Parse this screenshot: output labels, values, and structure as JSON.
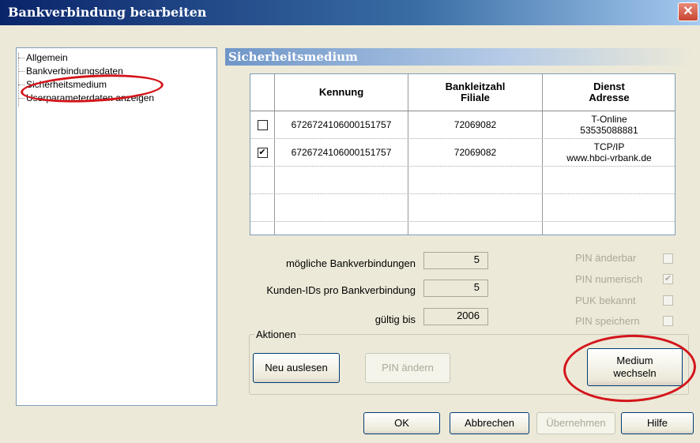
{
  "window": {
    "title": "Bankverbindung bearbeiten",
    "close_glyph": "✕"
  },
  "tree": {
    "items": [
      {
        "label": "Allgemein"
      },
      {
        "label": "Bankverbindungsdaten"
      },
      {
        "label": "Sicherheitsmedium"
      },
      {
        "label": "Userparameterdaten anzeigen"
      }
    ]
  },
  "panel": {
    "title": "Sicherheitsmedium"
  },
  "table": {
    "headers": {
      "kennung": "Kennung",
      "blz_1": "Bankleitzahl",
      "blz_2": "Filiale",
      "dienst_1": "Dienst",
      "dienst_2": "Adresse"
    },
    "rows": [
      {
        "checked": "",
        "kennung": "6726724106000151757",
        "blz": "72069082",
        "dienst": "T-Online",
        "adresse": "53535088881"
      },
      {
        "checked": "✔",
        "kennung": "6726724106000151757",
        "blz": "72069082",
        "dienst": "TCP/IP",
        "adresse": "www.hbci-vrbank.de"
      }
    ]
  },
  "info": {
    "moegliche_label": "mögliche Bankverbindungen",
    "moegliche_value": "5",
    "kunden_label": "Kunden-IDs pro Bankverbindung",
    "kunden_value": "5",
    "gueltig_label": "gültig bis",
    "gueltig_value": "2006"
  },
  "flags": [
    {
      "label": "PIN änderbar",
      "checked": ""
    },
    {
      "label": "PIN numerisch",
      "checked": "✔"
    },
    {
      "label": "PUK bekannt",
      "checked": ""
    },
    {
      "label": "PIN speichern",
      "checked": ""
    }
  ],
  "actions": {
    "group_label": "Aktionen",
    "neu_auslesen": "Neu auslesen",
    "pin_aendern": "PIN ändern",
    "medium_1": "Medium",
    "medium_2": "wechseln"
  },
  "footer": {
    "ok": "OK",
    "abbrechen": "Abbrechen",
    "uebernehmen": "Übernehmen",
    "hilfe": "Hilfe"
  },
  "colors": {
    "annotation": "#d4151b",
    "title_bar": "#0a246a"
  }
}
